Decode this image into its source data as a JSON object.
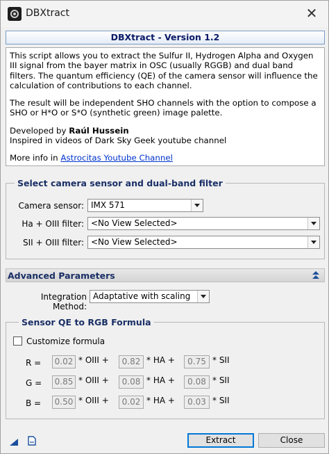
{
  "window": {
    "title": "DBXtract",
    "close_glyph": "✕",
    "icon": "dbxtract-app-icon"
  },
  "header": {
    "title": "DBXtract - Version 1.2"
  },
  "description": {
    "paragraph1": "This script allows you to extract the Sulfur II, Hydrogen Alpha and Oxygen III signal from the bayer matrix in OSC (usually RGGB) and dual band filters. The quantum efficiency (QE) of the camera sensor will influence the calculation of contributions to each channel.",
    "paragraph2": "The result will be independent SHO channels with the option to compose a SHO or H*O or S*O (synthetic green) image palette.",
    "developed_prefix": "Developed by ",
    "developer": "Raúl Hussein",
    "inspired": "Inspired in videos of Dark Sky Geek youtube channel",
    "more_info_prefix": "More info in ",
    "link_text": "Astrocitas Youtube Channel"
  },
  "sensor_section": {
    "legend": "Select camera sensor and dual-band filter",
    "camera_label": "Camera sensor:",
    "camera_value": "IMX 571",
    "ha_label": "Ha + OIII filter:",
    "ha_value": "<No View Selected>",
    "sii_label": "SII + OIII filter:",
    "sii_value": "<No View Selected>"
  },
  "advanced": {
    "title": "Advanced Parameters",
    "toggle_icon": "collapse-up-icon",
    "integration_label": "Integration Method:",
    "integration_value": "Adaptative with scaling"
  },
  "formula": {
    "legend": "Sensor QE to RGB Formula",
    "customize_label": "Customize formula",
    "customize_checked": false,
    "rows": [
      {
        "label": "R =",
        "oiii": "0.02",
        "ha": "0.82",
        "sii": "0.75"
      },
      {
        "label": "G =",
        "oiii": "0.85",
        "ha": "0.08",
        "sii": "0.08"
      },
      {
        "label": "B =",
        "oiii": "0.50",
        "ha": "0.02",
        "sii": "0.03"
      }
    ],
    "oiii_suffix": "* OIII +",
    "ha_suffix": "* HA +",
    "sii_suffix": "* SII"
  },
  "footer": {
    "extract_label": "Extract",
    "close_label": "Close",
    "new_instance_icon": "new-instance-icon",
    "documentation_icon": "documentation-icon"
  },
  "colors": {
    "legend": "#1a2f66",
    "link": "#0033cc",
    "default_button_border": "#0078d7"
  }
}
